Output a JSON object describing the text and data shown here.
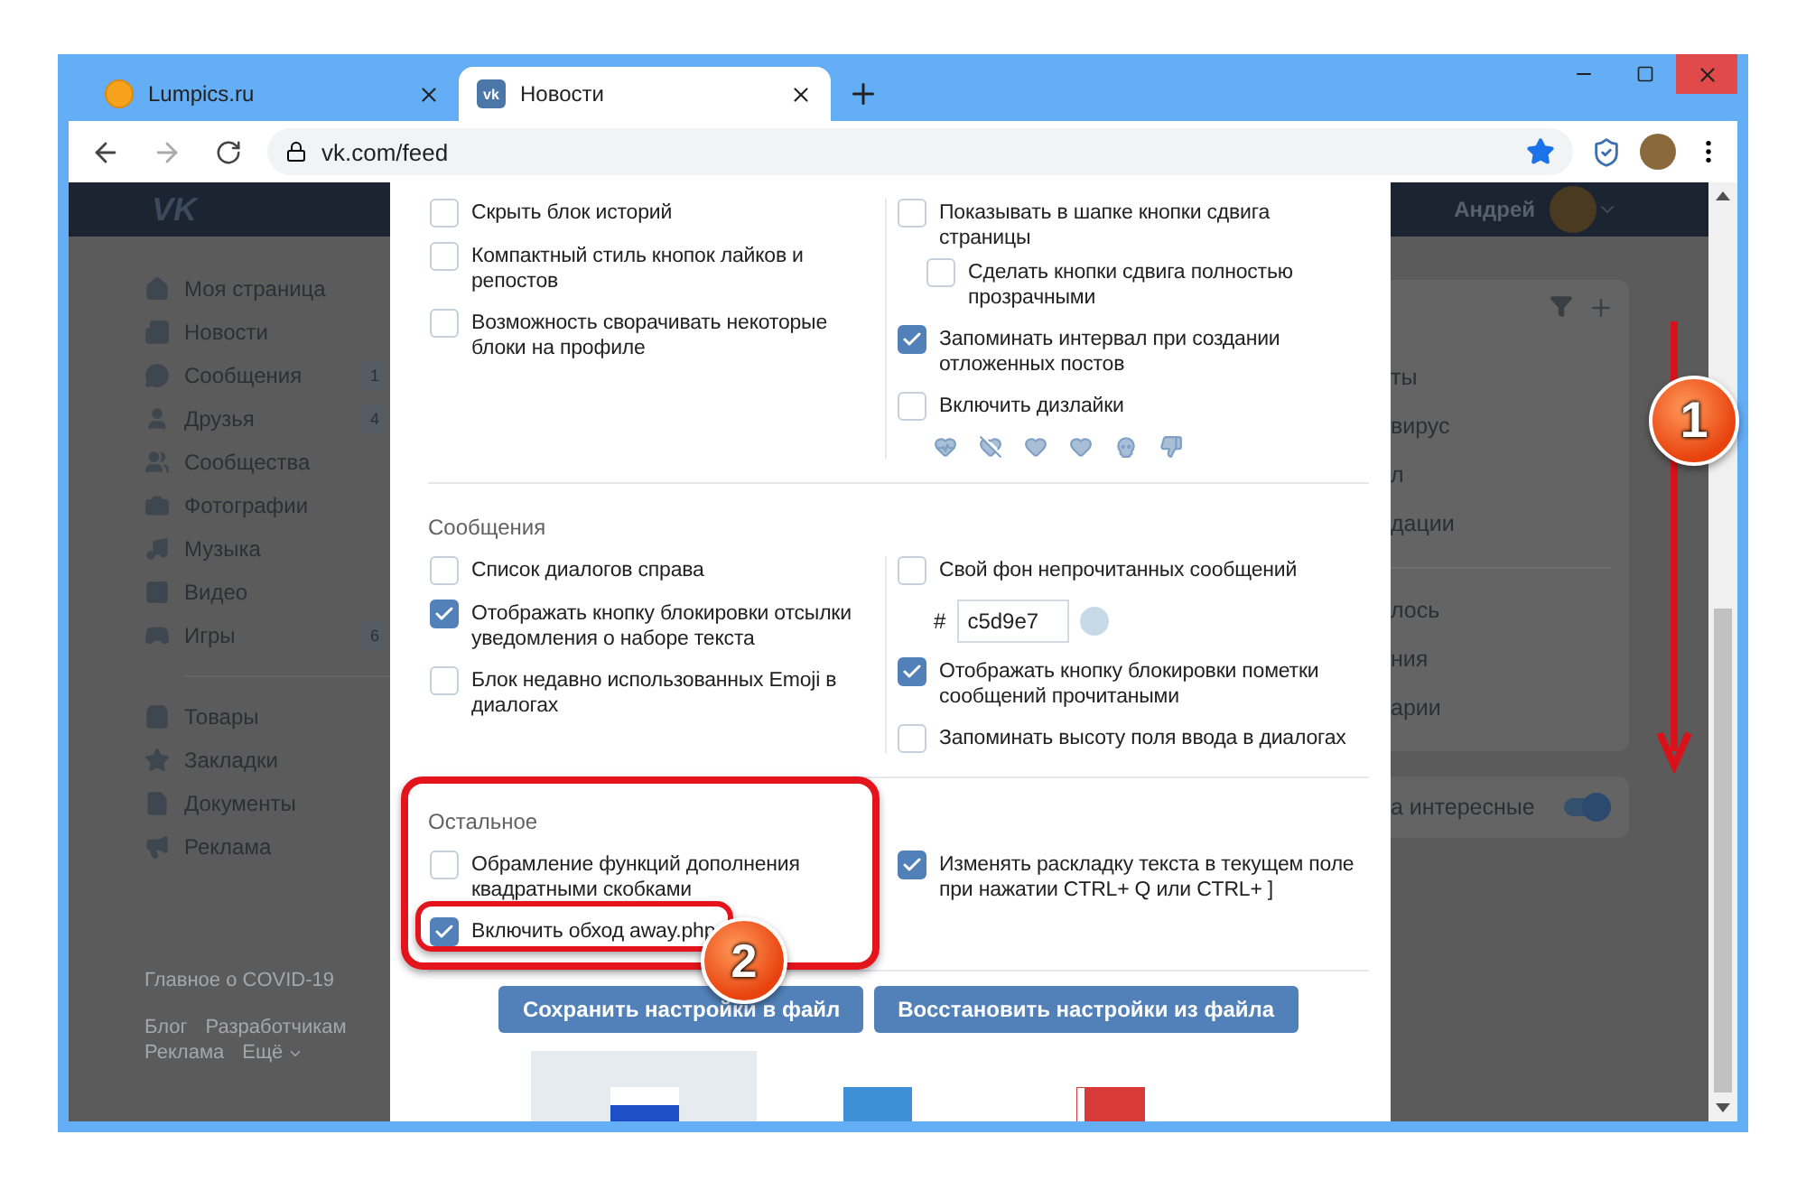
{
  "browser": {
    "tabs": [
      {
        "title": "Lumpics.ru",
        "selected": false,
        "favicon": {
          "kind": "dot"
        }
      },
      {
        "title": "Новости",
        "selected": true,
        "favicon": {
          "kind": "logo",
          "text": "vk"
        }
      }
    ],
    "url": "vk.com/feed"
  },
  "header": {
    "logo": "VK",
    "user_name": "Андрей"
  },
  "sidebar": {
    "groups": [
      [
        {
          "label": "Моя страница"
        },
        {
          "label": "Новости"
        },
        {
          "label": "Сообщения",
          "count": "1"
        },
        {
          "label": "Друзья",
          "count": "4"
        },
        {
          "label": "Сообщества"
        },
        {
          "label": "Фотографии"
        },
        {
          "label": "Музыка"
        },
        {
          "label": "Видео"
        },
        {
          "label": "Игры",
          "count": "6"
        }
      ],
      [
        {
          "label": "Товары"
        },
        {
          "label": "Закладки"
        },
        {
          "label": "Документы"
        },
        {
          "label": "Реклама"
        }
      ]
    ],
    "footer_link": "Главное о COVID-19",
    "links": [
      "Блог",
      "Разработчикам",
      "Реклама",
      "Ещё"
    ]
  },
  "right_column": {
    "card_texts": [
      "ты",
      "вирус",
      "л",
      "дации",
      "лось",
      "ния",
      "арии"
    ],
    "toggle_row": {
      "label": "а интересные",
      "on": true
    }
  },
  "modal": {
    "sections": [
      {
        "column_divider": true,
        "left": [
          {
            "kind": "checkbox",
            "label": "Скрыть блок историй",
            "checked": false
          },
          {
            "kind": "checkbox",
            "label": "Компактный стиль кнопок лайков и репостов",
            "checked": false
          },
          {
            "kind": "checkbox",
            "label": "Возможность сворачивать некоторые блоки на профиле",
            "checked": false
          }
        ],
        "right": [
          {
            "kind": "checkbox",
            "label": "Показывать в шапке кнопки сдвига страницы",
            "checked": false,
            "children": [
              {
                "kind": "checkbox",
                "label": "Сделать кнопки сдвига полностью прозрачными",
                "checked": false
              }
            ]
          },
          {
            "kind": "checkbox",
            "label": "Запоминать интервал при создании отложенных постов",
            "checked": true
          },
          {
            "kind": "checkbox",
            "label": "Включить дизлайки",
            "checked": false
          },
          {
            "kind": "icon_row"
          }
        ]
      },
      {
        "title": "Сообщения",
        "column_divider": true,
        "left": [
          {
            "kind": "checkbox",
            "label": "Список диалогов справа",
            "checked": false
          },
          {
            "kind": "checkbox",
            "label": "Отображать кнопку блокировки отсылки уведомления о наборе текста",
            "checked": true
          },
          {
            "kind": "checkbox",
            "label": "Блок недавно использованных Emoji в диалогах",
            "checked": false
          }
        ],
        "right": [
          {
            "kind": "checkbox",
            "label": "Свой фон непрочитанных сообщений",
            "checked": false
          },
          {
            "kind": "color_field",
            "prefix": "#",
            "value": "c5d9e7",
            "color": "#c5d9e7"
          },
          {
            "kind": "checkbox",
            "label": "Отображать кнопку блокировки пометки сообщений прочитаными",
            "checked": true
          },
          {
            "kind": "checkbox",
            "label": "Запоминать высоту поля ввода в диалогах",
            "checked": false
          }
        ]
      },
      {
        "title": "Остальное",
        "column_divider": false,
        "left": [
          {
            "kind": "checkbox",
            "label": "Обрамление функций дополнения квадратными скобками",
            "checked": false
          },
          {
            "kind": "checkbox",
            "label": "Включить обход away.php",
            "checked": true
          }
        ],
        "right": [
          {
            "kind": "checkbox",
            "label": "Изменять раскладку текста в текущем поле при нажатии CTRL+ Q или CTRL+ ]",
            "checked": true
          }
        ]
      }
    ],
    "buttons": [
      "Сохранить настройки в файл",
      "Восстановить настройки из файла"
    ],
    "languages": [
      {
        "kind": "ru",
        "selected": true
      },
      {
        "kind": "ua",
        "selected": false
      },
      {
        "kind": "by",
        "selected": false
      }
    ]
  },
  "annotations": {
    "steps": [
      "1",
      "2"
    ]
  }
}
